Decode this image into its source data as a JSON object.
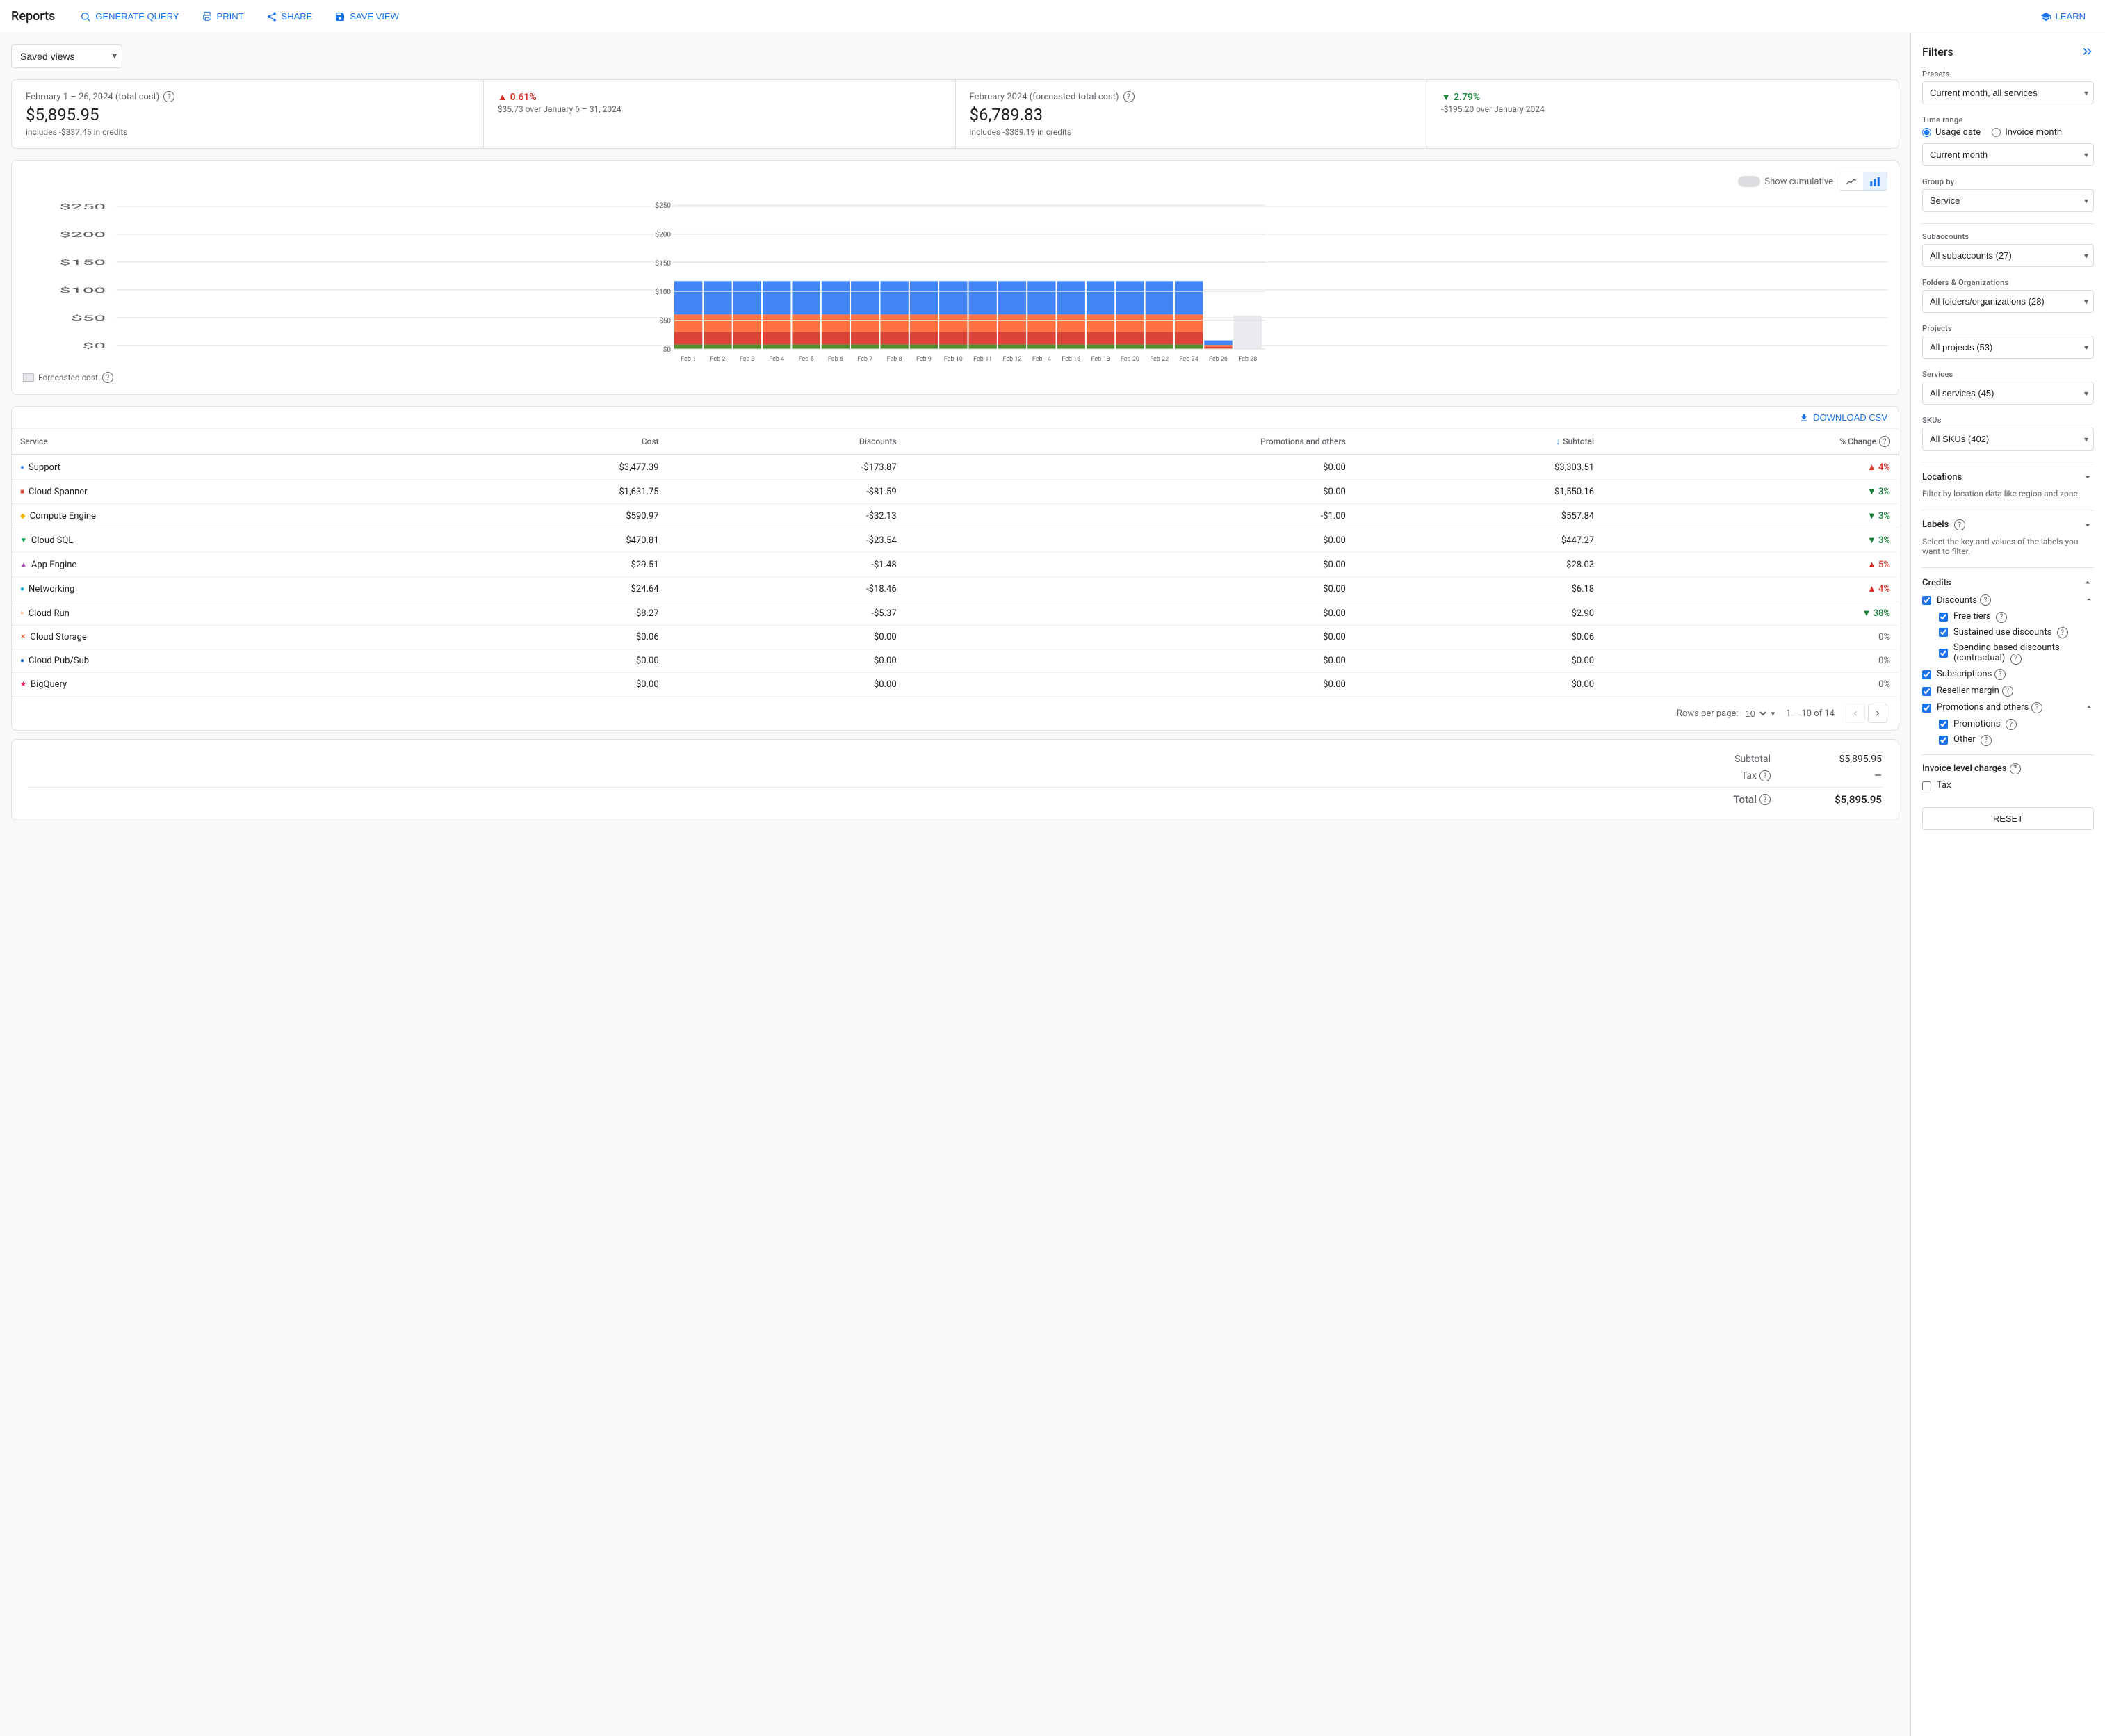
{
  "header": {
    "title": "Reports",
    "buttons": {
      "generate_query": "GENERATE QUERY",
      "print": "PRINT",
      "share": "SHARE",
      "save_view": "SAVE VIEW",
      "learn": "LEARN"
    }
  },
  "saved_views": {
    "label": "Saved views",
    "options": [
      "Saved views"
    ]
  },
  "summary": {
    "actual": {
      "title": "February 1 – 26, 2024 (total cost)",
      "amount": "$5,895.95",
      "credits": "includes -$337.45 in credits",
      "change_pct": "0.61%",
      "change_label": "$35.73 over January 6 – 31, 2024",
      "change_direction": "up"
    },
    "forecasted": {
      "title": "February 2024 (forecasted total cost)",
      "amount": "$6,789.83",
      "credits": "includes -$389.19 in credits",
      "change_pct": "2.79%",
      "change_label": "-$195.20 over January 2024",
      "change_direction": "down"
    }
  },
  "chart": {
    "show_cumulative": "Show cumulative",
    "y_labels": [
      "$250",
      "$200",
      "$150",
      "$100",
      "$50",
      "$0"
    ],
    "bars": [
      {
        "label": "Feb 1",
        "blue": 58,
        "orange": 30,
        "red": 22,
        "green": 8,
        "gray": 0
      },
      {
        "label": "Feb 2",
        "blue": 58,
        "orange": 30,
        "red": 22,
        "green": 8,
        "gray": 0
      },
      {
        "label": "Feb 3",
        "blue": 58,
        "orange": 30,
        "red": 22,
        "green": 8,
        "gray": 0
      },
      {
        "label": "Feb 4",
        "blue": 58,
        "orange": 30,
        "red": 22,
        "green": 8,
        "gray": 0
      },
      {
        "label": "Feb 5",
        "blue": 58,
        "orange": 30,
        "red": 22,
        "green": 8,
        "gray": 0
      },
      {
        "label": "Feb 6",
        "blue": 58,
        "orange": 30,
        "red": 22,
        "green": 8,
        "gray": 0
      },
      {
        "label": "Feb 7",
        "blue": 58,
        "orange": 30,
        "red": 22,
        "green": 8,
        "gray": 0
      },
      {
        "label": "Feb 8",
        "blue": 58,
        "orange": 30,
        "red": 22,
        "green": 8,
        "gray": 0
      },
      {
        "label": "Feb 9",
        "blue": 58,
        "orange": 30,
        "red": 22,
        "green": 8,
        "gray": 0
      },
      {
        "label": "Feb 10",
        "blue": 58,
        "orange": 30,
        "red": 22,
        "green": 8,
        "gray": 0
      },
      {
        "label": "Feb 11",
        "blue": 58,
        "orange": 30,
        "red": 22,
        "green": 8,
        "gray": 0
      },
      {
        "label": "Feb 12",
        "blue": 58,
        "orange": 30,
        "red": 22,
        "green": 8,
        "gray": 0
      },
      {
        "label": "Feb 14",
        "blue": 58,
        "orange": 30,
        "red": 22,
        "green": 8,
        "gray": 0
      },
      {
        "label": "Feb 16",
        "blue": 58,
        "orange": 30,
        "red": 22,
        "green": 8,
        "gray": 0
      },
      {
        "label": "Feb 18",
        "blue": 58,
        "orange": 30,
        "red": 22,
        "green": 8,
        "gray": 0
      },
      {
        "label": "Feb 20",
        "blue": 58,
        "orange": 30,
        "red": 22,
        "green": 8,
        "gray": 0
      },
      {
        "label": "Feb 22",
        "blue": 58,
        "orange": 30,
        "red": 22,
        "green": 8,
        "gray": 0
      },
      {
        "label": "Feb 24",
        "blue": 58,
        "orange": 30,
        "red": 22,
        "green": 8,
        "gray": 0
      },
      {
        "label": "Feb 26",
        "blue": 8,
        "orange": 3,
        "red": 3,
        "green": 1,
        "gray": 0
      },
      {
        "label": "Feb 28",
        "blue": 0,
        "orange": 0,
        "red": 0,
        "green": 0,
        "gray": 58
      }
    ],
    "forecasted_cost_label": "Forecasted cost"
  },
  "table": {
    "download_btn": "DOWNLOAD CSV",
    "columns": [
      "Service",
      "Cost",
      "Discounts",
      "Promotions and others",
      "Subtotal",
      "% Change"
    ],
    "rows": [
      {
        "service": "Support",
        "color": "#4285f4",
        "shape": "circle",
        "cost": "$3,477.39",
        "discounts": "-$173.87",
        "promotions": "$0.00",
        "subtotal": "$3,303.51",
        "change": "4%",
        "change_dir": "up"
      },
      {
        "service": "Cloud Spanner",
        "color": "#db4437",
        "shape": "square",
        "cost": "$1,631.75",
        "discounts": "-$81.59",
        "promotions": "$0.00",
        "subtotal": "$1,550.16",
        "change": "3%",
        "change_dir": "down"
      },
      {
        "service": "Compute Engine",
        "color": "#f4b400",
        "shape": "diamond",
        "cost": "$590.97",
        "discounts": "-$32.13",
        "promotions": "-$1.00",
        "subtotal": "$557.84",
        "change": "3%",
        "change_dir": "down"
      },
      {
        "service": "Cloud SQL",
        "color": "#0f9d58",
        "shape": "triangle-down",
        "cost": "$470.81",
        "discounts": "-$23.54",
        "promotions": "$0.00",
        "subtotal": "$447.27",
        "change": "3%",
        "change_dir": "down"
      },
      {
        "service": "App Engine",
        "color": "#ab47bc",
        "shape": "triangle-up",
        "cost": "$29.51",
        "discounts": "-$1.48",
        "promotions": "$0.00",
        "subtotal": "$28.03",
        "change": "5%",
        "change_dir": "up"
      },
      {
        "service": "Networking",
        "color": "#00acc1",
        "shape": "circle",
        "cost": "$24.64",
        "discounts": "-$18.46",
        "promotions": "$0.00",
        "subtotal": "$6.18",
        "change": "4%",
        "change_dir": "up"
      },
      {
        "service": "Cloud Run",
        "color": "#ff7043",
        "shape": "plus",
        "cost": "$8.27",
        "discounts": "-$5.37",
        "promotions": "$0.00",
        "subtotal": "$2.90",
        "change": "38%",
        "change_dir": "down"
      },
      {
        "service": "Cloud Storage",
        "color": "#f4511e",
        "shape": "x",
        "cost": "$0.06",
        "discounts": "$0.00",
        "promotions": "$0.00",
        "subtotal": "$0.06",
        "change": "0%",
        "change_dir": "neutral"
      },
      {
        "service": "Cloud Pub/Sub",
        "color": "#1565c0",
        "shape": "circle",
        "cost": "$0.00",
        "discounts": "$0.00",
        "promotions": "$0.00",
        "subtotal": "$0.00",
        "change": "0%",
        "change_dir": "neutral"
      },
      {
        "service": "BigQuery",
        "color": "#e91e63",
        "shape": "star",
        "cost": "$0.00",
        "discounts": "$0.00",
        "promotions": "$0.00",
        "subtotal": "$0.00",
        "change": "0%",
        "change_dir": "neutral"
      }
    ],
    "pagination": {
      "rows_per_page": "Rows per page:",
      "rows_per_page_value": "10",
      "page_info": "1 – 10 of 14"
    }
  },
  "totals": {
    "subtotal_label": "Subtotal",
    "subtotal_amount": "$5,895.95",
    "tax_label": "Tax",
    "tax_amount": "—",
    "total_label": "Total",
    "total_amount": "$5,895.95"
  },
  "filters": {
    "title": "Filters",
    "presets": {
      "label": "Presets",
      "value": "Current month, all services"
    },
    "time_range": {
      "label": "Time range",
      "usage_date": "Usage date",
      "invoice_month": "Invoice month",
      "period_label": "Current month"
    },
    "group_by": {
      "label": "Group by",
      "value": "Service"
    },
    "subaccounts": {
      "label": "Subaccounts",
      "value": "All subaccounts (27)"
    },
    "folders_orgs": {
      "label": "Folders & Organizations",
      "value": "All folders/organizations (28)"
    },
    "projects": {
      "label": "Projects",
      "value": "All projects (53)"
    },
    "services": {
      "label": "Services",
      "value": "All services (45)"
    },
    "skus": {
      "label": "SKUs",
      "value": "All SKUs (402)"
    },
    "locations": {
      "label": "Locations",
      "description": "Filter by location data like region and zone."
    },
    "labels": {
      "label": "Labels",
      "description": "Select the key and values of the labels you want to filter."
    },
    "credits": {
      "label": "Credits",
      "discounts": {
        "label": "Discounts",
        "checked": true,
        "items": [
          {
            "label": "Free tiers",
            "checked": true
          },
          {
            "label": "Sustained use discounts",
            "checked": true
          },
          {
            "label": "Spending based discounts (contractual)",
            "checked": true
          }
        ]
      },
      "subscriptions": {
        "label": "Subscriptions",
        "checked": true
      },
      "reseller_margin": {
        "label": "Reseller margin",
        "checked": true
      },
      "promotions_others": {
        "label": "Promotions and others",
        "checked": true,
        "items": [
          {
            "label": "Promotions",
            "checked": true
          },
          {
            "label": "Other",
            "checked": true
          }
        ]
      }
    },
    "invoice_charges": {
      "label": "Invoice level charges",
      "tax": {
        "label": "Tax",
        "checked": false
      }
    },
    "reset_btn": "RESET"
  }
}
